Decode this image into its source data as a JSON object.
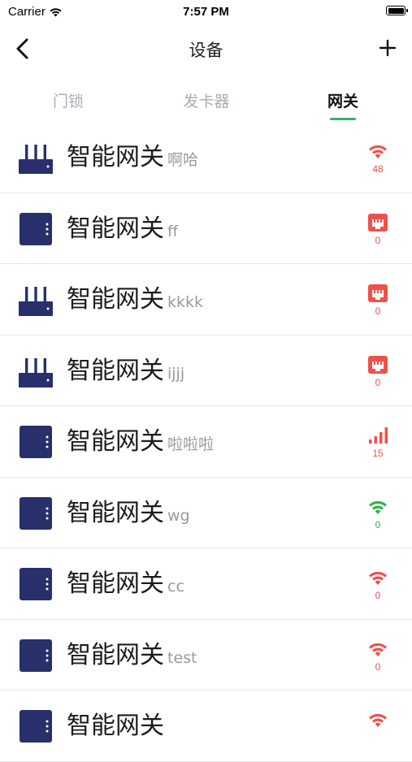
{
  "status_bar": {
    "carrier": "Carrier",
    "time": "7:57 PM"
  },
  "nav": {
    "title": "设备"
  },
  "tabs": [
    {
      "label": "门锁",
      "active": false
    },
    {
      "label": "发卡器",
      "active": false
    },
    {
      "label": "网关",
      "active": true
    }
  ],
  "colors": {
    "accent": "#2db56c",
    "device_icon": "#27306a",
    "signal_red": "#f0504a",
    "signal_green": "#36b14b"
  },
  "devices": [
    {
      "name": "智能网关",
      "alias": "啊哈",
      "icon": "router-icon",
      "signal_icon": "wifi-icon",
      "signal_value": "48",
      "signal_color": "#f0504a"
    },
    {
      "name": "智能网关",
      "alias": "ff",
      "icon": "gateway-box-icon",
      "signal_icon": "ethernet-icon",
      "signal_value": "0",
      "signal_color": "#f0504a"
    },
    {
      "name": "智能网关",
      "alias": "kkkk",
      "icon": "router-icon",
      "signal_icon": "ethernet-icon",
      "signal_value": "0",
      "signal_color": "#f0504a"
    },
    {
      "name": "智能网关",
      "alias": "ijjj",
      "icon": "router-icon",
      "signal_icon": "ethernet-icon",
      "signal_value": "0",
      "signal_color": "#f0504a"
    },
    {
      "name": "智能网关",
      "alias": "啦啦啦",
      "icon": "gateway-box-icon",
      "signal_icon": "cellular-signal-icon",
      "signal_value": "15",
      "signal_color": "#f0504a"
    },
    {
      "name": "智能网关",
      "alias": "wg",
      "icon": "gateway-box-icon",
      "signal_icon": "wifi-icon",
      "signal_value": "0",
      "signal_color": "#36b14b"
    },
    {
      "name": "智能网关",
      "alias": "cc",
      "icon": "gateway-box-icon",
      "signal_icon": "wifi-icon",
      "signal_value": "0",
      "signal_color": "#f0504a"
    },
    {
      "name": "智能网关",
      "alias": "test",
      "icon": "gateway-box-icon",
      "signal_icon": "wifi-icon",
      "signal_value": "0",
      "signal_color": "#f0504a"
    },
    {
      "name": "智能网关",
      "alias": "",
      "icon": "gateway-box-icon",
      "signal_icon": "wifi-icon",
      "signal_value": "",
      "signal_color": "#f0504a"
    }
  ]
}
